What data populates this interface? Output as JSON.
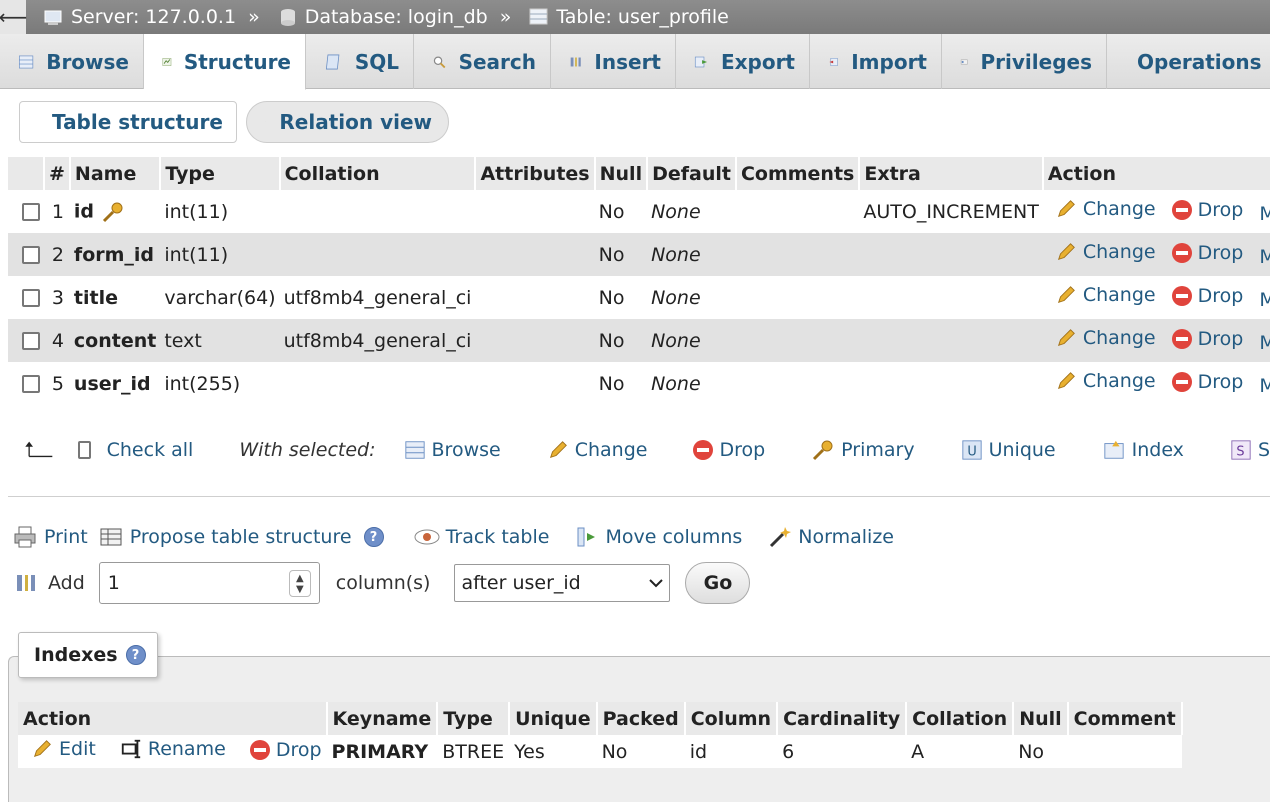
{
  "breadcrumb": {
    "server": "Server: 127.0.0.1",
    "database": "Database: login_db",
    "table": "Table: user_profile",
    "separator": "»"
  },
  "tabs": [
    {
      "label": "Browse",
      "icon": "browse-icon"
    },
    {
      "label": "Structure",
      "icon": "structure-icon",
      "active": true
    },
    {
      "label": "SQL",
      "icon": "sql-icon"
    },
    {
      "label": "Search",
      "icon": "search-icon"
    },
    {
      "label": "Insert",
      "icon": "insert-icon"
    },
    {
      "label": "Export",
      "icon": "export-icon"
    },
    {
      "label": "Import",
      "icon": "import-icon"
    },
    {
      "label": "Privileges",
      "icon": "privileges-icon"
    },
    {
      "label": "Operations",
      "icon": "operations-icon"
    }
  ],
  "subtabs": {
    "table_structure": "Table structure",
    "relation_view": "Relation view"
  },
  "structure": {
    "headers": [
      "#",
      "Name",
      "Type",
      "Collation",
      "Attributes",
      "Null",
      "Default",
      "Comments",
      "Extra",
      "Action"
    ],
    "rows": [
      {
        "num": "1",
        "name": "id",
        "type": "int(11)",
        "collation": "",
        "attributes": "",
        "null": "No",
        "default": "None",
        "comments": "",
        "extra": "AUTO_INCREMENT",
        "primary_key": true
      },
      {
        "num": "2",
        "name": "form_id",
        "type": "int(11)",
        "collation": "",
        "attributes": "",
        "null": "No",
        "default": "None",
        "comments": "",
        "extra": ""
      },
      {
        "num": "3",
        "name": "title",
        "type": "varchar(64)",
        "collation": "utf8mb4_general_ci",
        "attributes": "",
        "null": "No",
        "default": "None",
        "comments": "",
        "extra": ""
      },
      {
        "num": "4",
        "name": "content",
        "type": "text",
        "collation": "utf8mb4_general_ci",
        "attributes": "",
        "null": "No",
        "default": "None",
        "comments": "",
        "extra": ""
      },
      {
        "num": "5",
        "name": "user_id",
        "type": "int(255)",
        "collation": "",
        "attributes": "",
        "null": "No",
        "default": "None",
        "comments": "",
        "extra": ""
      }
    ],
    "actions": {
      "change": "Change",
      "drop": "Drop",
      "more": "More"
    }
  },
  "with_selected": {
    "check_all": "Check all",
    "label": "With selected:",
    "browse": "Browse",
    "change": "Change",
    "drop": "Drop",
    "primary": "Primary",
    "unique": "Unique",
    "index": "Index",
    "spatial": "S"
  },
  "tools": {
    "print": "Print",
    "propose": "Propose table structure",
    "track": "Track table",
    "move": "Move columns",
    "normalize": "Normalize"
  },
  "add_columns": {
    "label": "Add",
    "count": "1",
    "unit": "column(s)",
    "position": "after user_id",
    "go": "Go"
  },
  "indexes": {
    "legend": "Indexes",
    "headers": [
      "Action",
      "Keyname",
      "Type",
      "Unique",
      "Packed",
      "Column",
      "Cardinality",
      "Collation",
      "Null",
      "Comment"
    ],
    "actions": {
      "edit": "Edit",
      "rename": "Rename",
      "drop": "Drop"
    },
    "rows": [
      {
        "keyname": "PRIMARY",
        "type": "BTREE",
        "unique": "Yes",
        "packed": "No",
        "column": "id",
        "cardinality": "6",
        "collation": "A",
        "null": "No",
        "comment": ""
      }
    ]
  }
}
